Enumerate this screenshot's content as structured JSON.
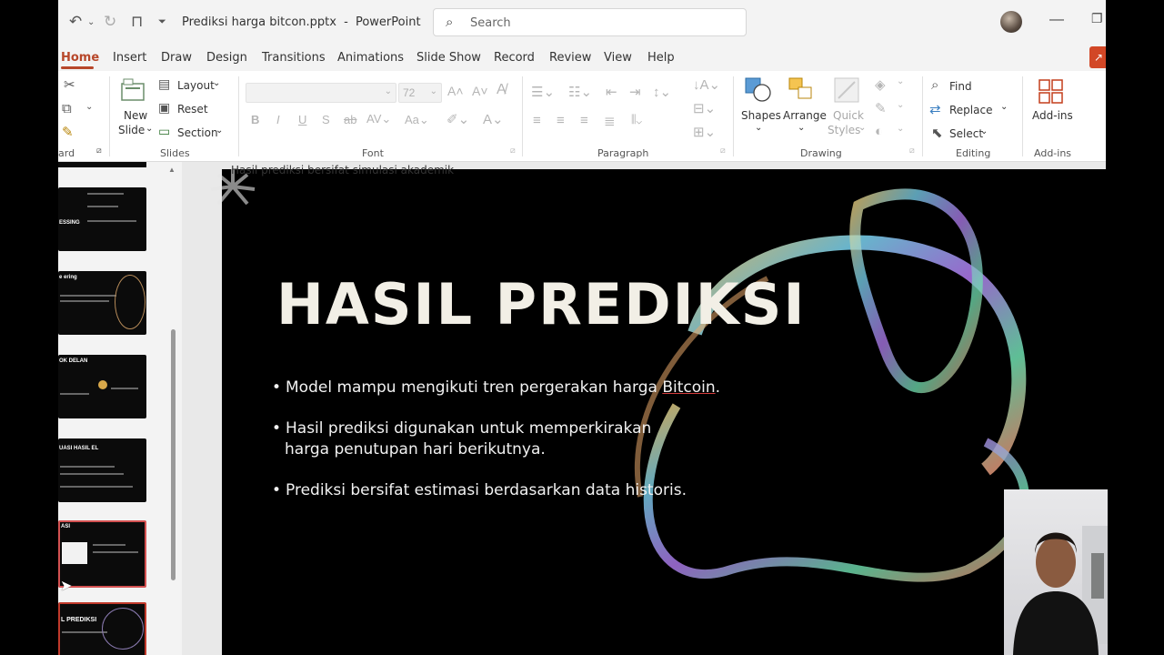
{
  "window": {
    "doc_title": "Prediksi harga bitcon.pptx",
    "app_name": "PowerPoint",
    "search_placeholder": "Search"
  },
  "tabs": [
    {
      "label": "Home",
      "active": true
    },
    {
      "label": "Insert"
    },
    {
      "label": "Draw"
    },
    {
      "label": "Design"
    },
    {
      "label": "Transitions"
    },
    {
      "label": "Animations"
    },
    {
      "label": "Slide Show"
    },
    {
      "label": "Record"
    },
    {
      "label": "Review"
    },
    {
      "label": "View"
    },
    {
      "label": "Help"
    }
  ],
  "ribbon": {
    "clipboard_label": "ard",
    "slides": {
      "new_slide": "New",
      "new_slide_2": "Slide",
      "layout": "Layout",
      "reset": "Reset",
      "section": "Section",
      "group_label": "Slides"
    },
    "font": {
      "size_value": "72",
      "group_label": "Font"
    },
    "paragraph": {
      "group_label": "Paragraph"
    },
    "drawing": {
      "shapes": "Shapes",
      "arrange": "Arrange",
      "quick": "Quick",
      "styles": "Styles",
      "group_label": "Drawing"
    },
    "editing": {
      "find": "Find",
      "replace": "Replace",
      "select": "Select",
      "group_label": "Editing"
    },
    "addins": {
      "label": "Add-ins",
      "group_label": "Add-ins"
    }
  },
  "thumbnails": [
    {
      "title": "ESSING"
    },
    {
      "title": "e ering"
    },
    {
      "title": "OK DELAN"
    },
    {
      "title": "UASI HASIL EL"
    },
    {
      "title": "ASI",
      "selected": true
    },
    {
      "title": "L PREDIKSI"
    }
  ],
  "comment_note": "Hasil prediksi bersifat simulasi akademik",
  "slide": {
    "title": "HASIL PREDIKSI",
    "bullets": [
      {
        "line1": "Model mampu mengikuti tren pergerakan harga ",
        "highlight": "Bitcoin",
        "line1_end": "."
      },
      {
        "line1": "Hasil prediksi digunakan untuk memperkirakan",
        "line2": "harga penutupan hari berikutnya."
      },
      {
        "line1": "Prediksi bersifat estimasi berdasarkan data historis."
      }
    ]
  },
  "colors": {
    "accent": "#b7472a",
    "slide_bg": "#000000",
    "title_text": "#f2efe6"
  }
}
